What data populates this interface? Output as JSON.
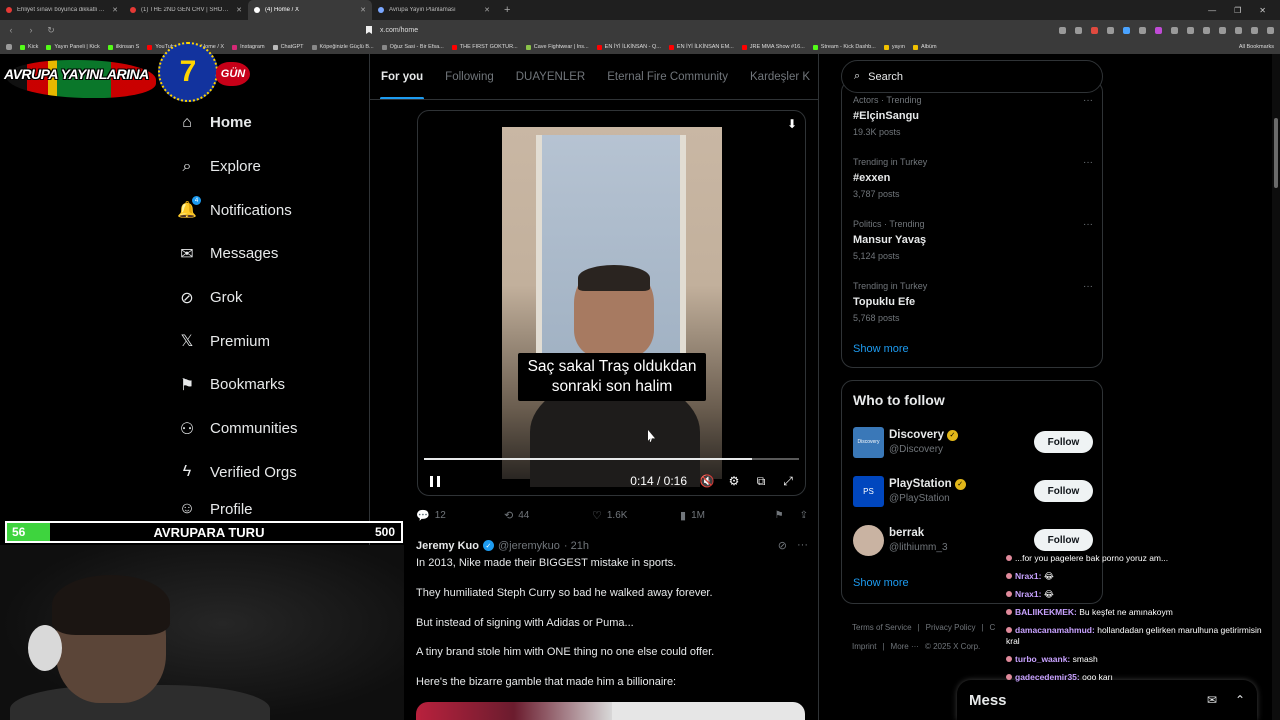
{
  "browser": {
    "tabs": [
      {
        "label": "Ehliyet sınavı boyunca dikkatli ve ku",
        "color": "#e53935",
        "active": false
      },
      {
        "label": "(1) THE 2ND GEN CRV | SHOULD YO",
        "color": "#e53935",
        "active": false
      },
      {
        "label": "(4) Home / X",
        "color": "#ffffff",
        "active": true
      },
      {
        "label": "Avrupa Yayın Planlaması",
        "color": "#7aa7ff",
        "active": false
      }
    ],
    "url": "x.com/home",
    "bookmarks": [
      {
        "label": "Kick",
        "color": "#53fc18"
      },
      {
        "label": "Yayın Paneli | Kick",
        "color": "#53fc18"
      },
      {
        "label": "ilkinsan S",
        "color": "#53fc18"
      },
      {
        "label": "YouTube",
        "color": "#ff0000"
      },
      {
        "label": "(4) Home / X",
        "color": "#ffffff"
      },
      {
        "label": "Instagram",
        "color": "#d62976"
      },
      {
        "label": "ChatGPT",
        "color": "#bbbbbb"
      },
      {
        "label": "Köpeğinizle Güçlü B...",
        "color": "#888888"
      },
      {
        "label": "Oğuz Sasi - Bir Efsa...",
        "color": "#888888"
      },
      {
        "label": "THE FIRST GOKTUR...",
        "color": "#ff0000"
      },
      {
        "label": "Cave Fightwear | Ins...",
        "color": "#8bc34a"
      },
      {
        "label": "EN İYİ İLKİNSAN - Q...",
        "color": "#ff0000"
      },
      {
        "label": "EN İYİ İLKİNSAN EM...",
        "color": "#ff0000"
      },
      {
        "label": "JRE MMA Show #16...",
        "color": "#ff0000"
      },
      {
        "label": "Stream - Kick Dashb...",
        "color": "#53fc18"
      },
      {
        "label": "yayın",
        "color": "#f2c200"
      },
      {
        "label": "Albüm",
        "color": "#f2c200"
      }
    ],
    "all_bookmarks": "All Bookmarks"
  },
  "logo": {
    "text": "AVRUPA YAYINLARINA",
    "number": "7",
    "suffix": "GÜN"
  },
  "sidebar": {
    "items": [
      {
        "label": "Home",
        "icon": "⌂",
        "active": true
      },
      {
        "label": "Explore",
        "icon": "⌕"
      },
      {
        "label": "Notifications",
        "icon": "🔔",
        "badge": "4"
      },
      {
        "label": "Messages",
        "icon": "✉"
      },
      {
        "label": "Grok",
        "icon": "⊘"
      },
      {
        "label": "Premium",
        "icon": "𝕏"
      },
      {
        "label": "Bookmarks",
        "icon": "⚑"
      },
      {
        "label": "Communities",
        "icon": "⚇"
      },
      {
        "label": "Verified Orgs",
        "icon": "ϟ"
      },
      {
        "label": "Profile",
        "icon": "☺"
      }
    ]
  },
  "feed": {
    "tabs": [
      "For you",
      "Following",
      "DUAYENLER",
      "Eternal Fire Community",
      "Kardeşler K"
    ],
    "video": {
      "caption": "Saç sakal Traş oldukdan sonraki son halim",
      "time": "0:14 / 0:16",
      "progress": 0.875
    },
    "actions": {
      "replies": "12",
      "reposts": "44",
      "likes": "1.6K",
      "views": "1M"
    },
    "post": {
      "name": "Jeremy Kuo",
      "handle": "@jeremykuo",
      "time": "· 21h",
      "paragraphs": [
        "In 2013, Nike made their BIGGEST mistake in sports.",
        "They humiliated Steph Curry so bad he walked away forever.",
        "But instead of signing with Adidas or Puma...",
        "A tiny brand stole him with ONE thing no one else could offer.",
        "Here's the bizarre gamble that made him a billionaire:"
      ]
    }
  },
  "right": {
    "search_placeholder": "Search",
    "trends": [
      {
        "meta": "Actors · Trending",
        "name": "#ElçinSangu",
        "count": "19.3K posts"
      },
      {
        "meta": "Trending in Turkey",
        "name": "#exxen",
        "count": "3,787 posts"
      },
      {
        "meta": "Politics · Trending",
        "name": "Mansur Yavaş",
        "count": "5,124 posts"
      },
      {
        "meta": "Trending in Turkey",
        "name": "Topuklu Efe",
        "count": "5,768 posts"
      }
    ],
    "show_more": "Show more",
    "who_to_follow": {
      "title": "Who to follow",
      "accounts": [
        {
          "name": "Discovery",
          "handle": "@Discovery",
          "avatar_text": "Discovery",
          "avatar_color": "#3a78b8",
          "verified": true
        },
        {
          "name": "PlayStation",
          "handle": "@PlayStation",
          "avatar_text": "PS",
          "avatar_color": "#0046be",
          "verified": true
        },
        {
          "name": "berrak",
          "handle": "@lithiumm_3",
          "avatar_text": "",
          "avatar_color": "#c9b3a2",
          "verified": false
        }
      ],
      "follow_label": "Follow",
      "show_more": "Show more"
    },
    "footer": [
      "Terms of Service",
      "|",
      "Privacy Policy",
      "|",
      "C",
      "Imprint",
      "|",
      "More ···",
      "© 2025 X Corp."
    ]
  },
  "stream": {
    "goal": {
      "current": "56",
      "label": "AVRUPARA TURU",
      "max": "500",
      "fill": 0.11
    }
  },
  "chat": [
    {
      "user": "",
      "text": "...for you pagelere bak porno yoruz am..."
    },
    {
      "user": "Nrax1:",
      "text": "😂"
    },
    {
      "user": "Nrax1:",
      "text": "😂"
    },
    {
      "user": "BALIIKEKMEK:",
      "text": "Bu keşfet ne amınakoym"
    },
    {
      "user": "damacanamahmud:",
      "text": "hollandadan gelirken marulhuna getirirmisin kral"
    },
    {
      "user": "turbo_waank:",
      "text": "smash"
    },
    {
      "user": "gadecedemir35:",
      "text": "ooo karı"
    }
  ],
  "messages_drawer": {
    "title": "Mess"
  }
}
